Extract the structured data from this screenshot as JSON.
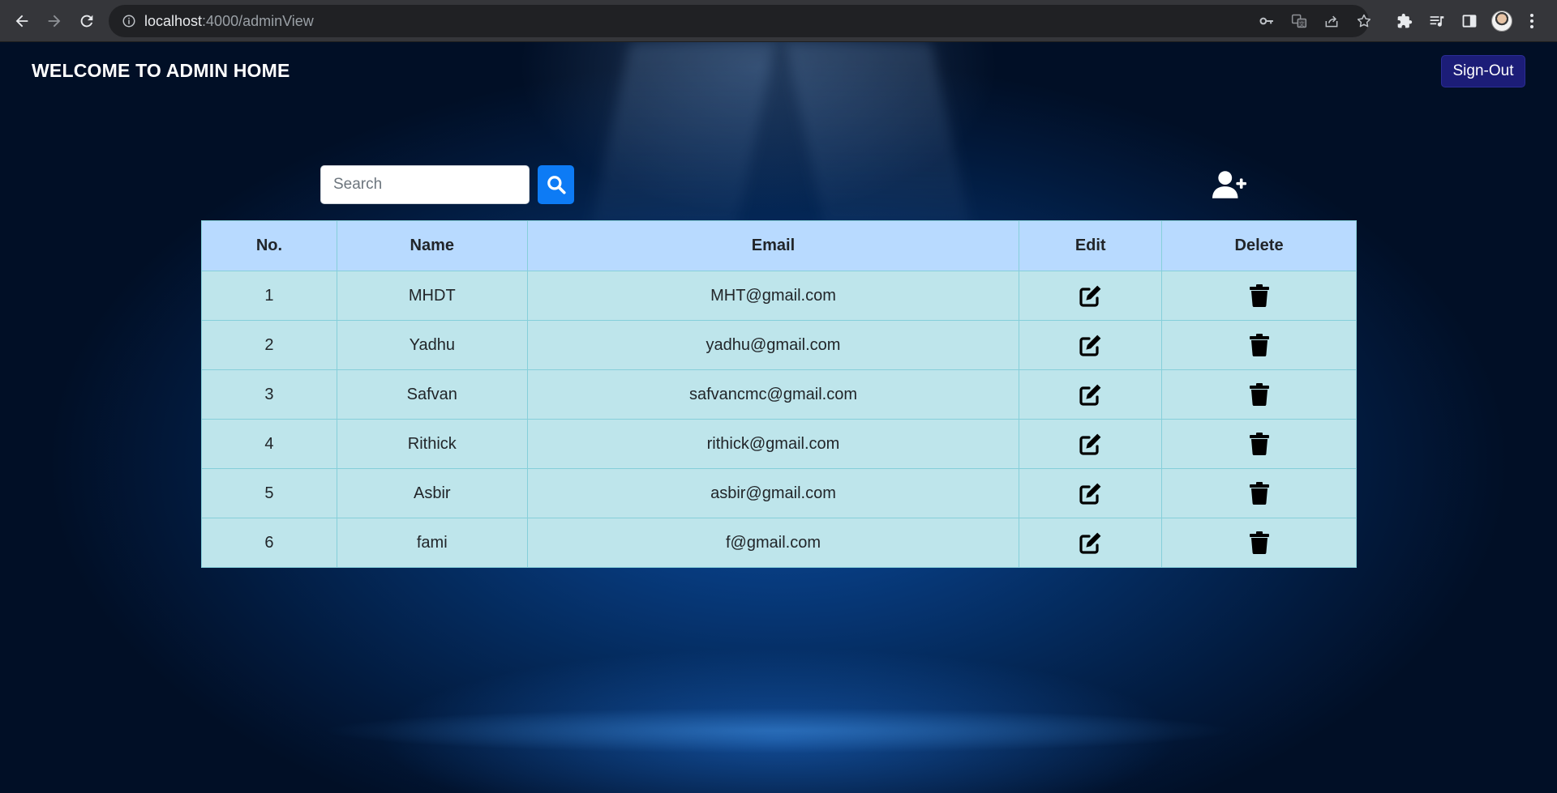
{
  "browser": {
    "url_host": "localhost",
    "url_rest": ":4000/adminView"
  },
  "header": {
    "title": "WELCOME TO ADMIN HOME",
    "signout_label": "Sign-Out"
  },
  "search": {
    "placeholder": "Search",
    "value": ""
  },
  "table": {
    "columns": [
      "No.",
      "Name",
      "Email",
      "Edit",
      "Delete"
    ],
    "rows": [
      {
        "no": "1",
        "name": "MHDT",
        "email": "MHT@gmail.com"
      },
      {
        "no": "2",
        "name": "Yadhu",
        "email": "yadhu@gmail.com"
      },
      {
        "no": "3",
        "name": "Safvan",
        "email": "safvancmc@gmail.com"
      },
      {
        "no": "4",
        "name": "Rithick",
        "email": "rithick@gmail.com"
      },
      {
        "no": "5",
        "name": "Asbir",
        "email": "asbir@gmail.com"
      },
      {
        "no": "6",
        "name": "fami",
        "email": "f@gmail.com"
      }
    ]
  },
  "icons": {
    "search": "search-icon",
    "add_user": "user-plus-icon",
    "edit": "edit-icon",
    "delete": "trash-icon"
  },
  "colors": {
    "signout_bg": "#1c1d78",
    "search_btn_bg": "#0d7bf5",
    "table_header_bg": "#b8daff",
    "table_row_bg": "#bee5eb",
    "table_border": "#86cfda"
  }
}
